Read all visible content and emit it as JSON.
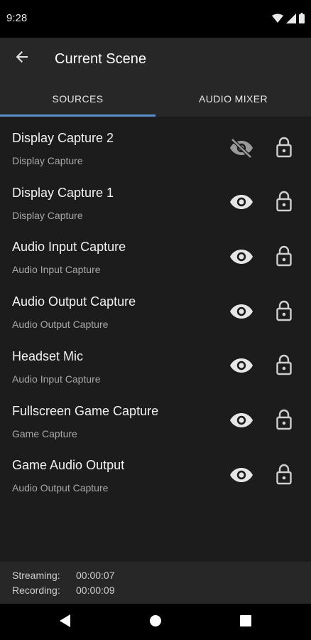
{
  "status_bar": {
    "time": "9:28"
  },
  "app_bar": {
    "title": "Current Scene"
  },
  "tabs": [
    {
      "label": "SOURCES",
      "active": true
    },
    {
      "label": "AUDIO MIXER",
      "active": false
    }
  ],
  "sources": [
    {
      "name": "Display Capture 2",
      "type": "Display Capture",
      "visible": false,
      "locked": true
    },
    {
      "name": "Display Capture 1",
      "type": "Display Capture",
      "visible": true,
      "locked": true
    },
    {
      "name": "Audio Input Capture",
      "type": "Audio Input Capture",
      "visible": true,
      "locked": true
    },
    {
      "name": "Audio Output Capture",
      "type": "Audio Output Capture",
      "visible": true,
      "locked": true
    },
    {
      "name": "Headset Mic",
      "type": "Audio Input Capture",
      "visible": true,
      "locked": true
    },
    {
      "name": "Fullscreen Game Capture",
      "type": "Game Capture",
      "visible": true,
      "locked": true
    },
    {
      "name": "Game Audio Output",
      "type": "Audio Output Capture",
      "visible": true,
      "locked": true
    }
  ],
  "footer": {
    "streaming_label": "Streaming:",
    "streaming_time": "00:00:07",
    "recording_label": "Recording:",
    "recording_time": "00:00:09"
  },
  "colors": {
    "accent": "#5b8fc9",
    "app_bar": "#272727",
    "list_bg": "#1c1c1c"
  }
}
